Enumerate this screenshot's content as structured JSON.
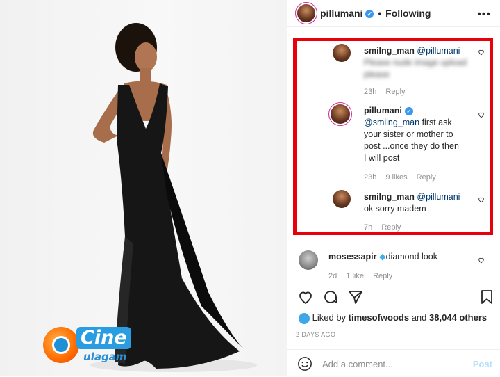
{
  "post": {
    "username": "pillumani",
    "follow_status": "Following",
    "separator": "•"
  },
  "comments": [
    {
      "username": "smilng_man",
      "mention": "@pillumani",
      "text": "Please nude image upload please",
      "time": "23h",
      "reply": "Reply"
    },
    {
      "username": "pillumani",
      "mention": "@smilng_man",
      "text_line1": "first ask",
      "text_line2": "your sister or mother to",
      "text_line3": "post ...once they do then",
      "text_line4": "I will post",
      "time": "23h",
      "likes": "9 likes",
      "reply": "Reply"
    },
    {
      "username": "smilng_man",
      "mention": "@pillumani",
      "text": "ok sorry madem",
      "time": "7h",
      "reply": "Reply"
    },
    {
      "username": "mosessapir",
      "text": "diamond look",
      "time": "2d",
      "likes": "1 like",
      "reply": "Reply"
    }
  ],
  "likes": {
    "prefix": "Liked by",
    "user": "timesofwoods",
    "middle": "and",
    "count": "38,044 others"
  },
  "date": "2 DAYS AGO",
  "add_comment": {
    "placeholder": "Add a comment...",
    "post": "Post"
  },
  "watermark": {
    "line1": "Cine",
    "line2": "ulagam"
  },
  "icons": [
    "heart-icon",
    "comment-icon",
    "share-icon",
    "bookmark-icon",
    "more-icon",
    "smile-icon",
    "verified-icon",
    "diamond-icon"
  ],
  "colors": {
    "highlight": "#e8000b",
    "verified": "#3897f0",
    "link": "#00376b"
  }
}
